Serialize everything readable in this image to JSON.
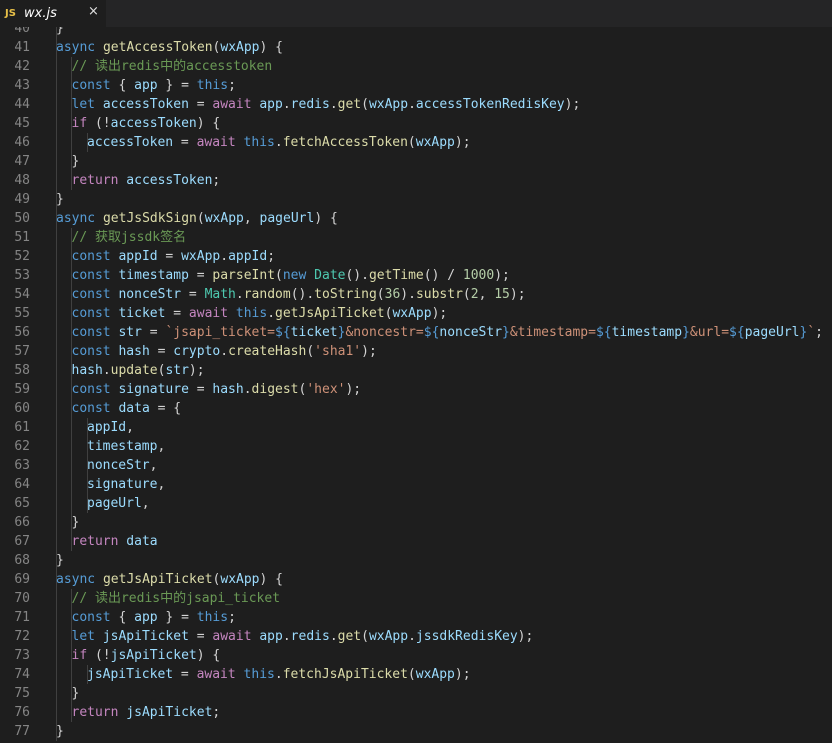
{
  "tab": {
    "icon_text": "JS",
    "filename": "wx.js",
    "close_glyph": "×"
  },
  "colors": {
    "keyword": "#569cd6",
    "control": "#c586c0",
    "function": "#dcdcaa",
    "variable": "#9cdcfe",
    "string": "#ce9178",
    "comment": "#6a9955",
    "number": "#b5cea8",
    "type": "#4ec9b0",
    "plain": "#d4d4d4",
    "line_number": "#858585",
    "background": "#1e1e1e"
  },
  "first_line_number": 40,
  "lines": [
    {
      "indent": 1,
      "tokens": [
        [
          "p",
          "}"
        ]
      ]
    },
    {
      "indent": 1,
      "tokens": [
        [
          "k",
          "async "
        ],
        [
          "f",
          "getAccessToken"
        ],
        [
          "p",
          "("
        ],
        [
          "v",
          "wxApp"
        ],
        [
          "p",
          ") {"
        ]
      ]
    },
    {
      "indent": 2,
      "tokens": [
        [
          "cm",
          "// 读出redis中的accesstoken"
        ]
      ]
    },
    {
      "indent": 2,
      "tokens": [
        [
          "k",
          "const "
        ],
        [
          "p",
          "{ "
        ],
        [
          "v",
          "app"
        ],
        [
          "p",
          " } = "
        ],
        [
          "k",
          "this"
        ],
        [
          "p",
          ";"
        ]
      ]
    },
    {
      "indent": 2,
      "tokens": [
        [
          "k",
          "let "
        ],
        [
          "v",
          "accessToken"
        ],
        [
          "p",
          " = "
        ],
        [
          "c",
          "await "
        ],
        [
          "v",
          "app"
        ],
        [
          "p",
          "."
        ],
        [
          "v",
          "redis"
        ],
        [
          "p",
          "."
        ],
        [
          "f",
          "get"
        ],
        [
          "p",
          "("
        ],
        [
          "v",
          "wxApp"
        ],
        [
          "p",
          "."
        ],
        [
          "v",
          "accessTokenRedisKey"
        ],
        [
          "p",
          ");"
        ]
      ]
    },
    {
      "indent": 2,
      "tokens": [
        [
          "c",
          "if "
        ],
        [
          "p",
          "(!"
        ],
        [
          "v",
          "accessToken"
        ],
        [
          "p",
          ") {"
        ]
      ]
    },
    {
      "indent": 3,
      "tokens": [
        [
          "v",
          "accessToken"
        ],
        [
          "p",
          " = "
        ],
        [
          "c",
          "await "
        ],
        [
          "k",
          "this"
        ],
        [
          "p",
          "."
        ],
        [
          "f",
          "fetchAccessToken"
        ],
        [
          "p",
          "("
        ],
        [
          "v",
          "wxApp"
        ],
        [
          "p",
          ");"
        ]
      ]
    },
    {
      "indent": 2,
      "tokens": [
        [
          "p",
          "}"
        ]
      ]
    },
    {
      "indent": 2,
      "tokens": [
        [
          "c",
          "return "
        ],
        [
          "v",
          "accessToken"
        ],
        [
          "p",
          ";"
        ]
      ]
    },
    {
      "indent": 1,
      "tokens": [
        [
          "p",
          "}"
        ]
      ]
    },
    {
      "indent": 1,
      "tokens": [
        [
          "k",
          "async "
        ],
        [
          "f",
          "getJsSdkSign"
        ],
        [
          "p",
          "("
        ],
        [
          "v",
          "wxApp"
        ],
        [
          "p",
          ", "
        ],
        [
          "v",
          "pageUrl"
        ],
        [
          "p",
          ") {"
        ]
      ]
    },
    {
      "indent": 2,
      "tokens": [
        [
          "cm",
          "// 获取jssdk签名"
        ]
      ]
    },
    {
      "indent": 2,
      "tokens": [
        [
          "k",
          "const "
        ],
        [
          "v",
          "appId"
        ],
        [
          "p",
          " = "
        ],
        [
          "v",
          "wxApp"
        ],
        [
          "p",
          "."
        ],
        [
          "v",
          "appId"
        ],
        [
          "p",
          ";"
        ]
      ]
    },
    {
      "indent": 2,
      "tokens": [
        [
          "k",
          "const "
        ],
        [
          "v",
          "timestamp"
        ],
        [
          "p",
          " = "
        ],
        [
          "f",
          "parseInt"
        ],
        [
          "p",
          "("
        ],
        [
          "k",
          "new "
        ],
        [
          "t",
          "Date"
        ],
        [
          "p",
          "()."
        ],
        [
          "f",
          "getTime"
        ],
        [
          "p",
          "() / "
        ],
        [
          "n",
          "1000"
        ],
        [
          "p",
          ");"
        ]
      ]
    },
    {
      "indent": 2,
      "tokens": [
        [
          "k",
          "const "
        ],
        [
          "v",
          "nonceStr"
        ],
        [
          "p",
          " = "
        ],
        [
          "t",
          "Math"
        ],
        [
          "p",
          "."
        ],
        [
          "f",
          "random"
        ],
        [
          "p",
          "()."
        ],
        [
          "f",
          "toString"
        ],
        [
          "p",
          "("
        ],
        [
          "n",
          "36"
        ],
        [
          "p",
          ")."
        ],
        [
          "f",
          "substr"
        ],
        [
          "p",
          "("
        ],
        [
          "n",
          "2"
        ],
        [
          "p",
          ", "
        ],
        [
          "n",
          "15"
        ],
        [
          "p",
          ");"
        ]
      ]
    },
    {
      "indent": 2,
      "tokens": [
        [
          "k",
          "const "
        ],
        [
          "v",
          "ticket"
        ],
        [
          "p",
          " = "
        ],
        [
          "c",
          "await "
        ],
        [
          "k",
          "this"
        ],
        [
          "p",
          "."
        ],
        [
          "f",
          "getJsApiTicket"
        ],
        [
          "p",
          "("
        ],
        [
          "v",
          "wxApp"
        ],
        [
          "p",
          ");"
        ]
      ]
    },
    {
      "indent": 2,
      "tokens": [
        [
          "k",
          "const "
        ],
        [
          "v",
          "str"
        ],
        [
          "p",
          " = "
        ],
        [
          "s",
          "`jsapi_ticket="
        ],
        [
          "k",
          "${"
        ],
        [
          "v",
          "ticket"
        ],
        [
          "k",
          "}"
        ],
        [
          "s",
          "&noncestr="
        ],
        [
          "k",
          "${"
        ],
        [
          "v",
          "nonceStr"
        ],
        [
          "k",
          "}"
        ],
        [
          "s",
          "&timestamp="
        ],
        [
          "k",
          "${"
        ],
        [
          "v",
          "timestamp"
        ],
        [
          "k",
          "}"
        ],
        [
          "s",
          "&url="
        ],
        [
          "k",
          "${"
        ],
        [
          "v",
          "pageUrl"
        ],
        [
          "k",
          "}"
        ],
        [
          "s",
          "`"
        ],
        [
          "p",
          ";"
        ]
      ]
    },
    {
      "indent": 2,
      "tokens": [
        [
          "k",
          "const "
        ],
        [
          "v",
          "hash"
        ],
        [
          "p",
          " = "
        ],
        [
          "v",
          "crypto"
        ],
        [
          "p",
          "."
        ],
        [
          "f",
          "createHash"
        ],
        [
          "p",
          "("
        ],
        [
          "s",
          "'sha1'"
        ],
        [
          "p",
          ");"
        ]
      ]
    },
    {
      "indent": 2,
      "tokens": [
        [
          "v",
          "hash"
        ],
        [
          "p",
          "."
        ],
        [
          "f",
          "update"
        ],
        [
          "p",
          "("
        ],
        [
          "v",
          "str"
        ],
        [
          "p",
          ");"
        ]
      ]
    },
    {
      "indent": 2,
      "tokens": [
        [
          "k",
          "const "
        ],
        [
          "v",
          "signature"
        ],
        [
          "p",
          " = "
        ],
        [
          "v",
          "hash"
        ],
        [
          "p",
          "."
        ],
        [
          "f",
          "digest"
        ],
        [
          "p",
          "("
        ],
        [
          "s",
          "'hex'"
        ],
        [
          "p",
          ");"
        ]
      ]
    },
    {
      "indent": 2,
      "tokens": [
        [
          "k",
          "const "
        ],
        [
          "v",
          "data"
        ],
        [
          "p",
          " = {"
        ]
      ]
    },
    {
      "indent": 3,
      "tokens": [
        [
          "v",
          "appId"
        ],
        [
          "p",
          ","
        ]
      ]
    },
    {
      "indent": 3,
      "tokens": [
        [
          "v",
          "timestamp"
        ],
        [
          "p",
          ","
        ]
      ]
    },
    {
      "indent": 3,
      "tokens": [
        [
          "v",
          "nonceStr"
        ],
        [
          "p",
          ","
        ]
      ]
    },
    {
      "indent": 3,
      "tokens": [
        [
          "v",
          "signature"
        ],
        [
          "p",
          ","
        ]
      ]
    },
    {
      "indent": 3,
      "tokens": [
        [
          "v",
          "pageUrl"
        ],
        [
          "p",
          ","
        ]
      ]
    },
    {
      "indent": 2,
      "tokens": [
        [
          "p",
          "}"
        ]
      ]
    },
    {
      "indent": 2,
      "tokens": [
        [
          "c",
          "return "
        ],
        [
          "v",
          "data"
        ]
      ]
    },
    {
      "indent": 1,
      "tokens": [
        [
          "p",
          "}"
        ]
      ]
    },
    {
      "indent": 1,
      "tokens": [
        [
          "k",
          "async "
        ],
        [
          "f",
          "getJsApiTicket"
        ],
        [
          "p",
          "("
        ],
        [
          "v",
          "wxApp"
        ],
        [
          "p",
          ") {"
        ]
      ]
    },
    {
      "indent": 2,
      "tokens": [
        [
          "cm",
          "// 读出redis中的jsapi_ticket"
        ]
      ]
    },
    {
      "indent": 2,
      "tokens": [
        [
          "k",
          "const "
        ],
        [
          "p",
          "{ "
        ],
        [
          "v",
          "app"
        ],
        [
          "p",
          " } = "
        ],
        [
          "k",
          "this"
        ],
        [
          "p",
          ";"
        ]
      ]
    },
    {
      "indent": 2,
      "tokens": [
        [
          "k",
          "let "
        ],
        [
          "v",
          "jsApiTicket"
        ],
        [
          "p",
          " = "
        ],
        [
          "c",
          "await "
        ],
        [
          "v",
          "app"
        ],
        [
          "p",
          "."
        ],
        [
          "v",
          "redis"
        ],
        [
          "p",
          "."
        ],
        [
          "f",
          "get"
        ],
        [
          "p",
          "("
        ],
        [
          "v",
          "wxApp"
        ],
        [
          "p",
          "."
        ],
        [
          "v",
          "jssdkRedisKey"
        ],
        [
          "p",
          ");"
        ]
      ]
    },
    {
      "indent": 2,
      "tokens": [
        [
          "c",
          "if "
        ],
        [
          "p",
          "(!"
        ],
        [
          "v",
          "jsApiTicket"
        ],
        [
          "p",
          ") {"
        ]
      ]
    },
    {
      "indent": 3,
      "tokens": [
        [
          "v",
          "jsApiTicket"
        ],
        [
          "p",
          " = "
        ],
        [
          "c",
          "await "
        ],
        [
          "k",
          "this"
        ],
        [
          "p",
          "."
        ],
        [
          "f",
          "fetchJsApiTicket"
        ],
        [
          "p",
          "("
        ],
        [
          "v",
          "wxApp"
        ],
        [
          "p",
          ");"
        ]
      ]
    },
    {
      "indent": 2,
      "tokens": [
        [
          "p",
          "}"
        ]
      ]
    },
    {
      "indent": 2,
      "tokens": [
        [
          "c",
          "return "
        ],
        [
          "v",
          "jsApiTicket"
        ],
        [
          "p",
          ";"
        ]
      ]
    },
    {
      "indent": 1,
      "tokens": [
        [
          "p",
          "}"
        ]
      ]
    }
  ]
}
